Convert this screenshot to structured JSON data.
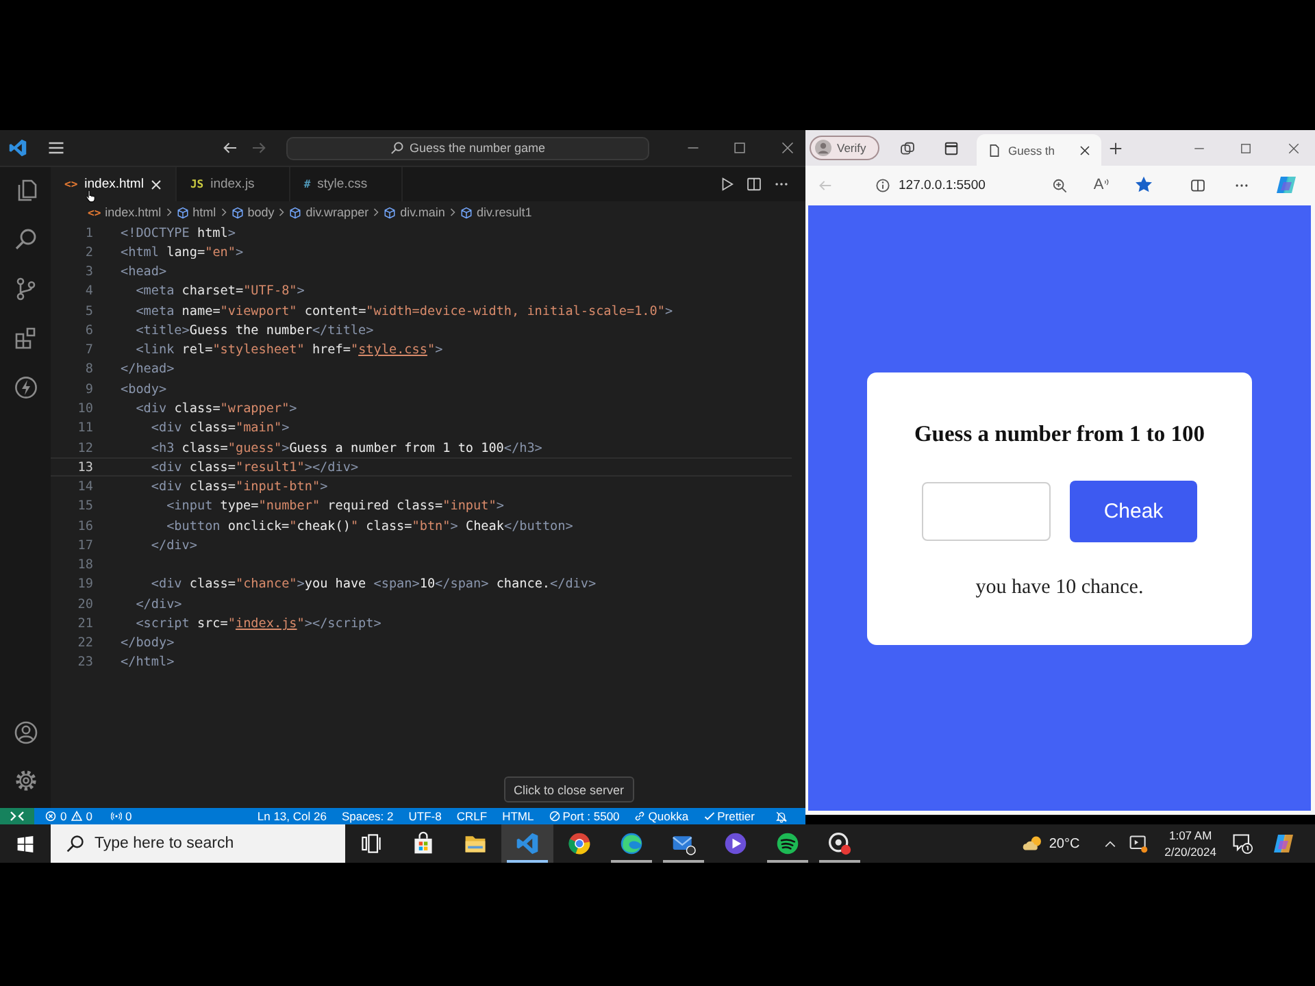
{
  "vscode": {
    "title_bar": {
      "command_center": "Guess the number game",
      "forward_disabled": true
    },
    "tabs": [
      {
        "icon": "<>",
        "label": "index.html",
        "kind": "html",
        "selected": true
      },
      {
        "icon": "JS",
        "label": "index.js",
        "kind": "js",
        "selected": false
      },
      {
        "icon": "#",
        "label": "style.css",
        "kind": "css",
        "selected": false
      }
    ],
    "breadcrumbs": [
      {
        "kind": "file",
        "icon": "<>",
        "label": "index.html"
      },
      {
        "kind": "element",
        "label": "html"
      },
      {
        "kind": "element",
        "label": "body"
      },
      {
        "kind": "element",
        "label": "div.wrapper"
      },
      {
        "kind": "element",
        "label": "div.main"
      },
      {
        "kind": "element",
        "label": "div.result1"
      }
    ],
    "editor": {
      "lines": [
        {
          "number": "1",
          "current": false,
          "tokens": [
            {
              "kind": "tag",
              "text": "<!DOCTYPE"
            },
            {
              "kind": "attr",
              "text": " html"
            },
            {
              "kind": "tag",
              "text": ">"
            }
          ]
        },
        {
          "number": "2",
          "current": false,
          "tokens": [
            {
              "kind": "tag",
              "text": "<html"
            },
            {
              "kind": "attr",
              "text": " lang"
            },
            {
              "kind": "text",
              "text": "="
            },
            {
              "kind": "str",
              "text": "\"en\""
            },
            {
              "kind": "tag",
              "text": ">"
            }
          ]
        },
        {
          "number": "3",
          "current": false,
          "tokens": [
            {
              "kind": "tag",
              "text": "<head>"
            }
          ]
        },
        {
          "number": "4",
          "current": false,
          "tokens": [
            {
              "kind": "tag",
              "text": "  <meta"
            },
            {
              "kind": "attr",
              "text": " charset"
            },
            {
              "kind": "text",
              "text": "="
            },
            {
              "kind": "str",
              "text": "\"UTF-8\""
            },
            {
              "kind": "tag",
              "text": ">"
            }
          ]
        },
        {
          "number": "5",
          "current": false,
          "tokens": [
            {
              "kind": "tag",
              "text": "  <meta"
            },
            {
              "kind": "attr",
              "text": " name"
            },
            {
              "kind": "text",
              "text": "="
            },
            {
              "kind": "str",
              "text": "\"viewport\""
            },
            {
              "kind": "attr",
              "text": " content"
            },
            {
              "kind": "text",
              "text": "="
            },
            {
              "kind": "str",
              "text": "\"width=device-width, initial-scale=1.0\""
            },
            {
              "kind": "tag",
              "text": ">"
            }
          ]
        },
        {
          "number": "6",
          "current": false,
          "tokens": [
            {
              "kind": "tag",
              "text": "  <title>"
            },
            {
              "kind": "text",
              "text": "Guess the number"
            },
            {
              "kind": "tag",
              "text": "</title>"
            }
          ]
        },
        {
          "number": "7",
          "current": false,
          "tokens": [
            {
              "kind": "tag",
              "text": "  <link"
            },
            {
              "kind": "attr",
              "text": " rel"
            },
            {
              "kind": "text",
              "text": "="
            },
            {
              "kind": "str",
              "text": "\"stylesheet\""
            },
            {
              "kind": "attr",
              "text": " href"
            },
            {
              "kind": "text",
              "text": "="
            },
            {
              "kind": "str",
              "text": "\""
            },
            {
              "kind": "link",
              "text": "style.css"
            },
            {
              "kind": "str",
              "text": "\""
            },
            {
              "kind": "tag",
              "text": ">"
            }
          ]
        },
        {
          "number": "8",
          "current": false,
          "tokens": [
            {
              "kind": "tag",
              "text": "</head>"
            }
          ]
        },
        {
          "number": "9",
          "current": false,
          "tokens": [
            {
              "kind": "tag",
              "text": "<body>"
            }
          ]
        },
        {
          "number": "10",
          "current": false,
          "tokens": [
            {
              "kind": "tag",
              "text": "  <div"
            },
            {
              "kind": "attr",
              "text": " class"
            },
            {
              "kind": "text",
              "text": "="
            },
            {
              "kind": "str",
              "text": "\"wrapper\""
            },
            {
              "kind": "tag",
              "text": ">"
            }
          ]
        },
        {
          "number": "11",
          "current": false,
          "tokens": [
            {
              "kind": "tag",
              "text": "    <div"
            },
            {
              "kind": "attr",
              "text": " class"
            },
            {
              "kind": "text",
              "text": "="
            },
            {
              "kind": "str",
              "text": "\"main\""
            },
            {
              "kind": "tag",
              "text": ">"
            }
          ]
        },
        {
          "number": "12",
          "current": false,
          "tokens": [
            {
              "kind": "tag",
              "text": "    <h3"
            },
            {
              "kind": "attr",
              "text": " class"
            },
            {
              "kind": "text",
              "text": "="
            },
            {
              "kind": "str",
              "text": "\"guess\""
            },
            {
              "kind": "tag",
              "text": ">"
            },
            {
              "kind": "text",
              "text": "Guess a number from 1 to 100"
            },
            {
              "kind": "tag",
              "text": "</h3>"
            }
          ]
        },
        {
          "number": "13",
          "current": true,
          "tokens": [
            {
              "kind": "tag",
              "text": "    <div"
            },
            {
              "kind": "attr",
              "text": " class"
            },
            {
              "kind": "text",
              "text": "="
            },
            {
              "kind": "str",
              "text": "\"result1\""
            },
            {
              "kind": "tag",
              "text": "></div>"
            }
          ]
        },
        {
          "number": "14",
          "current": false,
          "tokens": [
            {
              "kind": "tag",
              "text": "    <div"
            },
            {
              "kind": "attr",
              "text": " class"
            },
            {
              "kind": "text",
              "text": "="
            },
            {
              "kind": "str",
              "text": "\"input-btn\""
            },
            {
              "kind": "tag",
              "text": ">"
            }
          ]
        },
        {
          "number": "15",
          "current": false,
          "tokens": [
            {
              "kind": "tag",
              "text": "      <input"
            },
            {
              "kind": "attr",
              "text": " type"
            },
            {
              "kind": "text",
              "text": "="
            },
            {
              "kind": "str",
              "text": "\"number\""
            },
            {
              "kind": "attr",
              "text": " required class"
            },
            {
              "kind": "text",
              "text": "="
            },
            {
              "kind": "str",
              "text": "\"input\""
            },
            {
              "kind": "tag",
              "text": ">"
            }
          ]
        },
        {
          "number": "16",
          "current": false,
          "tokens": [
            {
              "kind": "tag",
              "text": "      <button"
            },
            {
              "kind": "attr",
              "text": " onclick"
            },
            {
              "kind": "text",
              "text": "="
            },
            {
              "kind": "str",
              "text": "\""
            },
            {
              "kind": "text",
              "text": "cheak()"
            },
            {
              "kind": "str",
              "text": "\""
            },
            {
              "kind": "attr",
              "text": " class"
            },
            {
              "kind": "text",
              "text": "="
            },
            {
              "kind": "str",
              "text": "\"btn\""
            },
            {
              "kind": "tag",
              "text": ">"
            },
            {
              "kind": "text",
              "text": " Cheak"
            },
            {
              "kind": "tag",
              "text": "</button>"
            }
          ]
        },
        {
          "number": "17",
          "current": false,
          "tokens": [
            {
              "kind": "tag",
              "text": "    </div>"
            }
          ]
        },
        {
          "number": "18",
          "current": false
        },
        {
          "number": "19",
          "current": false,
          "tokens": [
            {
              "kind": "tag",
              "text": "    <div"
            },
            {
              "kind": "attr",
              "text": " class"
            },
            {
              "kind": "text",
              "text": "="
            },
            {
              "kind": "str",
              "text": "\"chance\""
            },
            {
              "kind": "tag",
              "text": ">"
            },
            {
              "kind": "text",
              "text": "you have "
            },
            {
              "kind": "tag",
              "text": "<span>"
            },
            {
              "kind": "text",
              "text": "10"
            },
            {
              "kind": "tag",
              "text": "</span>"
            },
            {
              "kind": "text",
              "text": " chance."
            },
            {
              "kind": "tag",
              "text": "</div>"
            }
          ]
        },
        {
          "number": "20",
          "current": false,
          "tokens": [
            {
              "kind": "tag",
              "text": "  </div>"
            }
          ]
        },
        {
          "number": "21",
          "current": false,
          "tokens": [
            {
              "kind": "tag",
              "text": "  <script"
            },
            {
              "kind": "attr",
              "text": " src"
            },
            {
              "kind": "text",
              "text": "="
            },
            {
              "kind": "str",
              "text": "\""
            },
            {
              "kind": "link",
              "text": "index.js"
            },
            {
              "kind": "str",
              "text": "\""
            },
            {
              "kind": "tag",
              "text": "></script>"
            }
          ]
        },
        {
          "number": "22",
          "current": false,
          "tokens": [
            {
              "kind": "tag",
              "text": "</body>"
            }
          ]
        },
        {
          "number": "23",
          "current": false,
          "tokens": [
            {
              "kind": "tag",
              "text": "</html>"
            }
          ]
        }
      ]
    },
    "tooltip": "Click to close server",
    "status_bar": {
      "errors": "0",
      "warnings": "0",
      "ports": "0",
      "items": [
        {
          "kind": "text",
          "label": "Ln 13, Col 26"
        },
        {
          "kind": "text",
          "label": "Spaces: 2"
        },
        {
          "kind": "text",
          "label": "UTF-8"
        },
        {
          "kind": "text",
          "label": "CRLF"
        },
        {
          "kind": "text",
          "label": "HTML"
        },
        {
          "kind": "port",
          "label": "Port : 5500"
        },
        {
          "kind": "quokka",
          "label": "Quokka"
        },
        {
          "kind": "prettier",
          "label": "Prettier"
        }
      ]
    }
  },
  "browser": {
    "profile": "Verify",
    "tab": {
      "title": "Guess th"
    },
    "address_bar": {
      "back_disabled": true,
      "url": "127.0.0.1:5500",
      "read_aloud": "A",
      "favorite": true
    },
    "page": {
      "heading": "Guess a number from 1 to 100",
      "button": "Cheak",
      "chance": "you have 10 chance."
    }
  },
  "taskbar": {
    "search_placeholder": "Type here to search",
    "apps": [
      {
        "kind": "task-view",
        "selected": false,
        "running": false
      },
      {
        "kind": "store",
        "selected": false,
        "running": false
      },
      {
        "kind": "explorer",
        "selected": false,
        "running": false
      },
      {
        "kind": "vscode",
        "selected": true,
        "running": true
      },
      {
        "kind": "chrome",
        "selected": false,
        "running": false
      },
      {
        "kind": "edge",
        "selected": false,
        "running": true
      },
      {
        "kind": "mail",
        "selected": false,
        "running": true
      },
      {
        "kind": "media",
        "selected": false,
        "running": false
      },
      {
        "kind": "spotify",
        "selected": false,
        "running": true
      },
      {
        "kind": "recorder",
        "selected": false,
        "running": true
      }
    ],
    "weather": "20°C",
    "time": "1:07 AM",
    "date": "2/20/2024"
  }
}
